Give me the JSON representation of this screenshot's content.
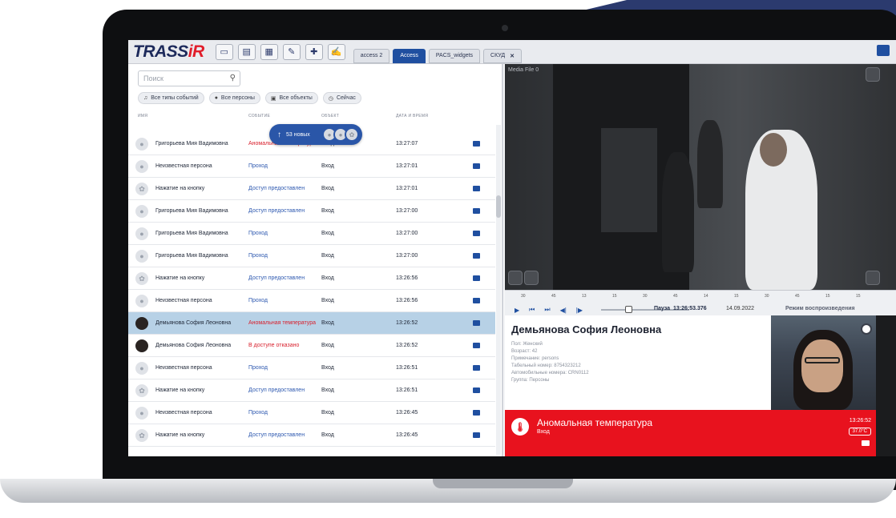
{
  "app": {
    "logo_main": "TRASS",
    "logo_accent": "iR"
  },
  "toolbar": {
    "icons": [
      "tape-icon",
      "chat-icon",
      "grid-icon",
      "edit-icon",
      "puzzle-icon",
      "pen-icon"
    ]
  },
  "tabs": [
    {
      "label": "access 2",
      "active": false
    },
    {
      "label": "Access",
      "active": true
    },
    {
      "label": "PACS_widgets",
      "active": false
    },
    {
      "label": "СКУД",
      "active": false,
      "closable": true
    }
  ],
  "search": {
    "placeholder": "Поиск"
  },
  "filters": [
    {
      "label": "Все типы событий",
      "icon": "bell-icon"
    },
    {
      "label": "Все персоны",
      "icon": "person-icon"
    },
    {
      "label": "Все объекты",
      "icon": "building-icon"
    },
    {
      "label": "Сейчас",
      "icon": "clock-icon"
    }
  ],
  "columns": {
    "name": "ИМЯ",
    "event": "СОБЫТИЕ",
    "object": "ОБЪЕКТ",
    "datetime": "ДАТА И ВРЕМЯ"
  },
  "new_events": {
    "label": "53 новых"
  },
  "rows": [
    {
      "name": "Григорьева Мия Вадимовна",
      "event": "Аномальная температура",
      "object": "Вход",
      "time": "13:27:07",
      "kind": "person",
      "red": true
    },
    {
      "name": "Неизвестная персона",
      "event": "Проход",
      "object": "Вход",
      "time": "13:27:01",
      "kind": "person",
      "red": false
    },
    {
      "name": "Нажатие на кнопку",
      "event": "Доступ предоставлен",
      "object": "Вход",
      "time": "13:27:01",
      "kind": "gear",
      "red": false
    },
    {
      "name": "Григорьева Мия Вадимовна",
      "event": "Доступ предоставлен",
      "object": "Вход",
      "time": "13:27:00",
      "kind": "person",
      "red": false
    },
    {
      "name": "Григорьева Мия Вадимовна",
      "event": "Проход",
      "object": "Вход",
      "time": "13:27:00",
      "kind": "person",
      "red": false
    },
    {
      "name": "Григорьева Мия Вадимовна",
      "event": "Проход",
      "object": "Вход",
      "time": "13:27:00",
      "kind": "person",
      "red": false
    },
    {
      "name": "Нажатие на кнопку",
      "event": "Доступ предоставлен",
      "object": "Вход",
      "time": "13:26:56",
      "kind": "gear",
      "red": false
    },
    {
      "name": "Неизвестная персона",
      "event": "Проход",
      "object": "Вход",
      "time": "13:26:56",
      "kind": "person",
      "red": false
    },
    {
      "name": "Демьянова София Леоновна",
      "event": "Аномальная температура",
      "object": "Вход",
      "time": "13:26:52",
      "kind": "photo",
      "red": true,
      "selected": true
    },
    {
      "name": "Демьянова София Леоновна",
      "event": "В доступе отказано",
      "object": "Вход",
      "time": "13:26:52",
      "kind": "photo",
      "red": true
    },
    {
      "name": "Неизвестная персона",
      "event": "Проход",
      "object": "Вход",
      "time": "13:26:51",
      "kind": "person",
      "red": false
    },
    {
      "name": "Нажатие на кнопку",
      "event": "Доступ предоставлен",
      "object": "Вход",
      "time": "13:26:51",
      "kind": "gear",
      "red": false
    },
    {
      "name": "Неизвестная персона",
      "event": "Проход",
      "object": "Вход",
      "time": "13:26:45",
      "kind": "person",
      "red": false
    },
    {
      "name": "Нажатие на кнопку",
      "event": "Доступ предоставлен",
      "object": "Вход",
      "time": "13:26:45",
      "kind": "gear",
      "red": false
    }
  ],
  "video": {
    "title": "Media File 0"
  },
  "timeline": {
    "ticks": [
      "30",
      "45",
      "13",
      "15",
      "30",
      "45",
      "14",
      "15",
      "30",
      "45",
      "15",
      "15"
    ],
    "status": "Пауза",
    "time": "13:26:53.376",
    "date": "14.09.2022",
    "mode": "Режим воспроизведения"
  },
  "card": {
    "name": "Демьянова София Леоновна",
    "info": [
      "Пол: Женский",
      "Возраст: 42",
      "Примечание: persons",
      "Табельный номер: 8754323212",
      "Автомобильные номера: CRN0112",
      "Группа: Персоны"
    ]
  },
  "alarm": {
    "title": "Аномальная температура",
    "subtitle": "Вход",
    "time": "13:26:52",
    "temperature": "37.0°C",
    "color": "#e8121e"
  }
}
